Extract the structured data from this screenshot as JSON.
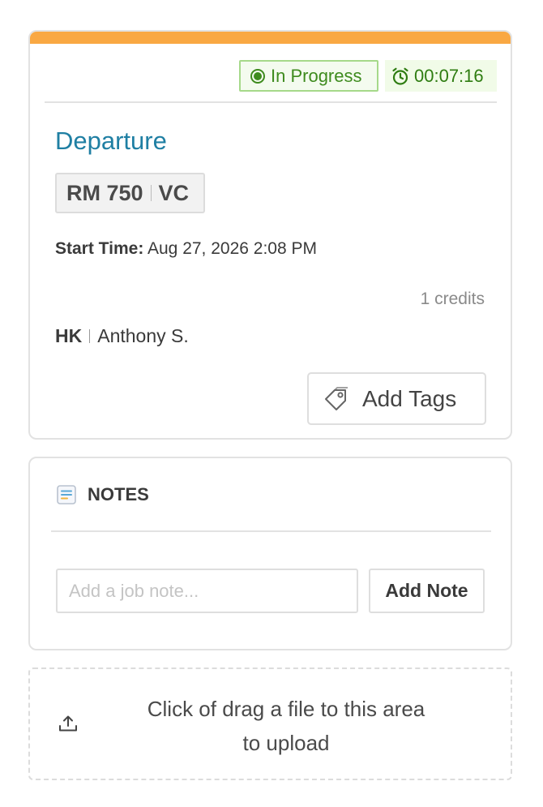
{
  "job": {
    "status": "In Progress",
    "timer": "00:07:16",
    "title": "Departure",
    "room": "RM 750",
    "room_status": "VC",
    "start_label": "Start Time:",
    "start_value": "Aug 27, 2026 2:08 PM",
    "credits": "1 credits",
    "assignee_code": "HK",
    "assignee_name": "Anthony S.",
    "add_tags_label": "Add Tags"
  },
  "notes": {
    "header": "NOTES",
    "input_placeholder": "Add a job note...",
    "input_value": "",
    "add_label": "Add Note"
  },
  "upload": {
    "line1": "Click of drag a file to this area",
    "line2": "to upload"
  },
  "colors": {
    "accent": "#f9a843",
    "status_green": "#3e8b1e",
    "title_blue": "#1f7fa3"
  },
  "icons": {
    "status": "status-dot-icon",
    "timer": "stopwatch-icon",
    "tags": "tag-icon",
    "notes": "document-icon",
    "upload": "upload-icon"
  }
}
